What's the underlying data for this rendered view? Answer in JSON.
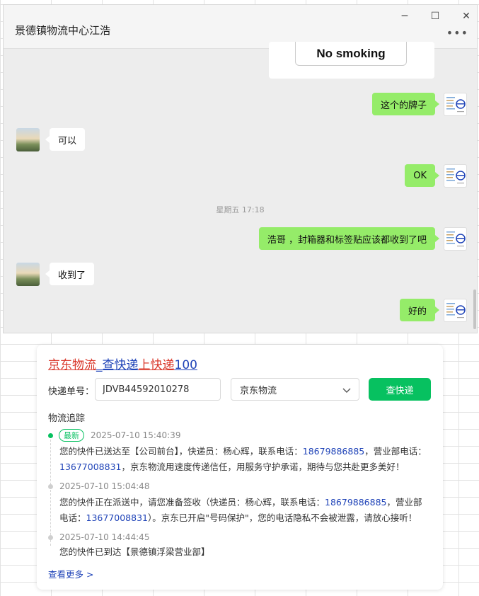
{
  "chat": {
    "title": "景德镇物流中心江浩",
    "window_buttons": {
      "minimize": "─",
      "maximize": "☐",
      "close": "✕"
    },
    "more": "•••",
    "card_sign_text": "No smoking",
    "messages": [
      {
        "side": "right",
        "text": "这个的牌子"
      },
      {
        "side": "left",
        "text": "可以"
      },
      {
        "side": "right",
        "text": "OK"
      },
      {
        "side": "right",
        "text": "浩哥 ，封箱器和标签贴应该都收到了吧"
      },
      {
        "side": "left",
        "text": "收到了"
      },
      {
        "side": "right",
        "text": "好的"
      }
    ],
    "timestamp": "星期五 17:18"
  },
  "express": {
    "title_parts": [
      "京东物流",
      "_",
      "查快递",
      "上",
      "快递",
      "100"
    ],
    "label_no": "快递单号：",
    "tracking_number": "JDVB44592010278",
    "company": "京东物流",
    "query_button": "查快递",
    "track_heading": "物流追踪",
    "badge_new": "最新",
    "events": [
      {
        "time": "2025-07-10 15:40:39",
        "text_a": "您的快件已送达至【公司前台】，快递员：杨心辉，联系电话：",
        "phone1": "18679886885",
        "text_b": "，营业部电话：",
        "phone2": "13677008831",
        "text_c": "，京东物流用速度传递信任，用服务守护承诺，期待与您共赴更多美好！"
      },
      {
        "time": "2025-07-10 15:04:48",
        "text_a": "您的快件正在派送中，请您准备签收（快递员：杨心辉，联系电话：",
        "phone1": "18679886885",
        "text_b": "，营业部电话：",
        "phone2": "13677008831",
        "text_c": "）。京东已开启\"号码保护\"，您的电话隐私不会被泄露，请放心接听！"
      },
      {
        "time": "2025-07-10 14:44:45",
        "text": "您的快件已到达【景德镇浮梁营业部】"
      }
    ],
    "more_link": "查看更多 >"
  },
  "colors": {
    "accent_green": "#07c160",
    "bubble_green": "#95ec69",
    "title_red": "#d9372a",
    "link_blue": "#2044b8"
  }
}
